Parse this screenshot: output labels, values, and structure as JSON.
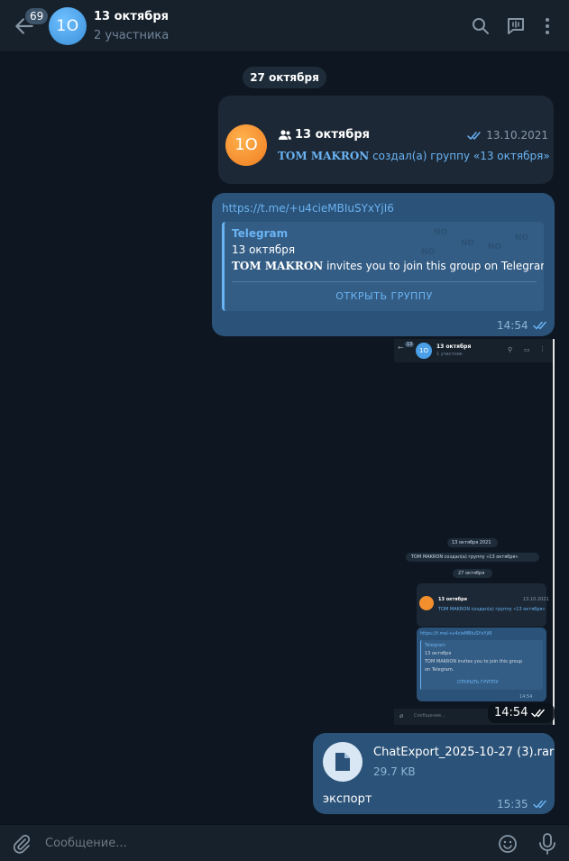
{
  "header": {
    "back_badge": "69",
    "avatar_initials": "1O",
    "title": "13 октября",
    "subtitle": "2 участника",
    "icons": [
      "back-arrow-icon",
      "search-icon",
      "video-chat-icon",
      "more-vert-icon"
    ]
  },
  "date_separator": "27 октября",
  "service_message": {
    "avatar_initials": "1O",
    "title": "13 октября",
    "date": "13.10.2021",
    "author": "TOM MAKRON",
    "text": " создал(а) группу «13 октября»",
    "icons": [
      "group-icon",
      "double-check-icon"
    ]
  },
  "link_message": {
    "url": "https://t.me/+u4cieMBIuSYxYjI6",
    "preview": {
      "site": "Telegram",
      "title": "13 октября",
      "author": "TOM MAKRON",
      "desc": " invites you to join this group on Telegram.",
      "button": "ОТКРЫТЬ ГРУППУ"
    },
    "time": "14:54"
  },
  "screenshot_message": {
    "time": "14:54",
    "content": {
      "badge": "13",
      "avatar_initials": "1O",
      "title": "13 октября",
      "subtitle": "1 участник",
      "date_pill_1": "13 октября 2021",
      "service_line": "TOM MAKRON создал(а) группу «13 октября»",
      "date_pill_2": "27 октября",
      "card_title": "13 октября",
      "card_date": "13.10.2021",
      "card_text": "TOM MAKRON создал(а) группу «13 октября»",
      "link": "https://t.me/+u4cieMBIuSYxYjI6",
      "pv_site": "Telegram",
      "pv_title": "13 октября",
      "pv_line1": "TOM MAKRON invites you to join this group",
      "pv_line2": "on Telegram.",
      "pv_button": "ОТКРЫТЬ ГРУППУ",
      "inner_time": "14:54",
      "composer_placeholder": "Сообщение..."
    }
  },
  "file_message": {
    "file_name": "ChatExport_2025-10-27 (3).rar",
    "file_size": "29.7 KB",
    "caption": "экспорт",
    "time": "15:35",
    "icon": "file-icon"
  },
  "composer": {
    "placeholder": "Сообщение...",
    "icons": [
      "attach-icon",
      "emoji-icon",
      "mic-icon"
    ]
  },
  "colors": {
    "background": "#0e1621",
    "header": "#17212b",
    "outgoing_bubble": "#2b5278",
    "link": "#6ab3f3",
    "avatar_blue": "#4a9fe8",
    "avatar_orange": "#f38f2d"
  }
}
